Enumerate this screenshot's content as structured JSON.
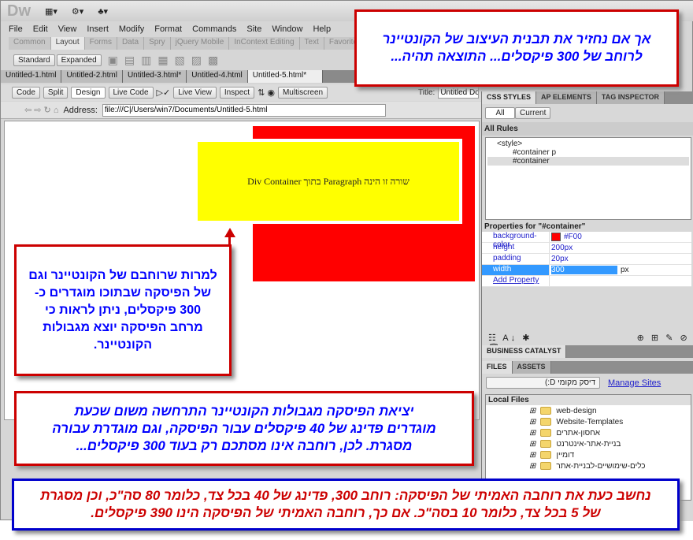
{
  "app": {
    "logo": "Dw"
  },
  "menu": [
    "File",
    "Edit",
    "View",
    "Insert",
    "Modify",
    "Format",
    "Commands",
    "Site",
    "Window",
    "Help"
  ],
  "insert_tabs": [
    "Common",
    "Layout",
    "Forms",
    "Data",
    "Spry",
    "jQuery Mobile",
    "InContext Editing",
    "Text",
    "Favorites"
  ],
  "insert_active": "Layout",
  "insert_tool": {
    "standard": "Standard",
    "expanded": "Expanded"
  },
  "doc_tabs": [
    "Untitled-1.html",
    "Untitled-2.html",
    "Untitled-3.html*",
    "Untitled-4.html",
    "Untitled-5.html*"
  ],
  "doc_toolbar": {
    "code": "Code",
    "split": "Split",
    "design": "Design",
    "live_code": "Live Code",
    "live_view": "Live View",
    "inspect": "Inspect",
    "multiscreen": "Multiscreen",
    "title_label": "Title:",
    "title_value": "Untitled Docu"
  },
  "address": {
    "label": "Address:",
    "value": "file:///C|/Users/win7/Documents/Untitled-5.html"
  },
  "design_view": {
    "paragraph_text": "שורה זו הינה Paragraph בתוך Div Container",
    "container_color": "#FF0000",
    "paragraph_color": "#FFFF00"
  },
  "css_panel": {
    "tabs": [
      "CSS STYLES",
      "AP ELEMENTS",
      "TAG INSPECTOR"
    ],
    "modes": [
      "All",
      "Current"
    ],
    "all_rules_label": "All Rules",
    "rules": [
      "<style>",
      "#container p",
      "#container"
    ],
    "properties_title": "Properties for \"#container\"",
    "properties": [
      {
        "name": "background-color",
        "value": "#F00"
      },
      {
        "name": "height",
        "value": "200px"
      },
      {
        "name": "padding",
        "value": "20px"
      },
      {
        "name": "width",
        "value": "300",
        "unit": "px"
      }
    ],
    "add_property": "Add Property"
  },
  "business_catalyst": "BUSINESS CATALYST",
  "files_panel": {
    "tabs": [
      "FILES",
      "ASSETS"
    ],
    "drive": "דיסק מקומי D:)",
    "manage_sites": "Manage Sites",
    "local_files": "Local Files",
    "items": [
      "web-design",
      "Website-Templates",
      "אחסון-אתרים",
      "בניית-אתר-אינטרנט",
      "דומיין",
      "כלים-שימושיים-לבניית-אתר"
    ]
  },
  "callouts": {
    "top": "אך אם נחזיר את תבנית העיצוב של הקונטיינר לרוחב של 300 פיקסלים... התוצאה תהיה...",
    "left": "למרות שרוחבם של הקונטיינר וגם של הפיסקה שבתוכו מוגדרים כ- 300 פיקסלים, ניתן לראות כי מרחב הפיסקה יוצא מגבולות הקונטיינר.",
    "middle": "יציאת הפיסקה מגבולות הקונטיינר התרחשה משום שכעת מוגדרים פדינג של 40 פיקסלים עבור הפיסקה, וגם מוגדרת עבורה מסגרת. לכן, רוחבה אינו מסתכם רק בעוד 300 פיקסלים...",
    "bottom": "נחשב כעת את רוחבה האמיתי של הפיסקה: רוחב 300, פדינג של 40 בכל צד, כלומר 80 סה\"כ, וכן מסגרת של 5 בכל צד, כלומר 10 בסה\"כ. אם כך, רוחבה האמיתי של הפיסקה הינו 390 פיקסלים."
  }
}
